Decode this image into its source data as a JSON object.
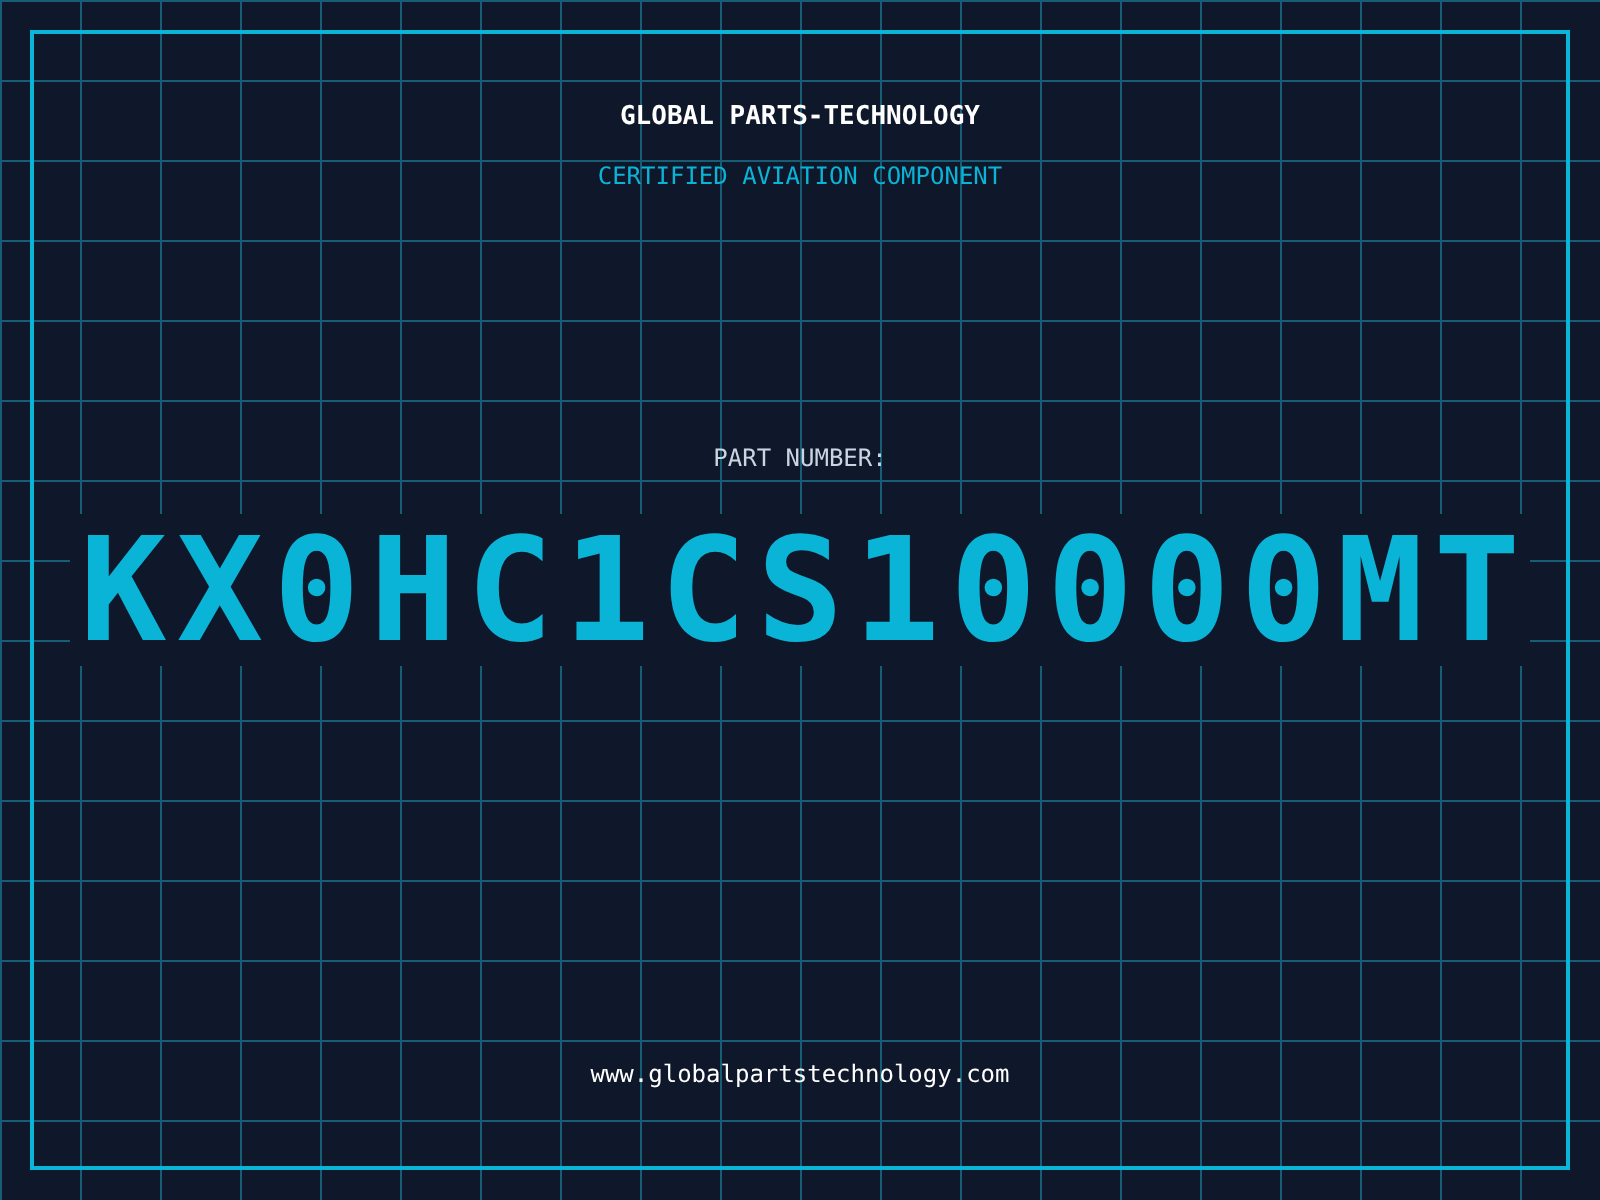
{
  "header": {
    "title": "GLOBAL PARTS-TECHNOLOGY",
    "subtitle": "CERTIFIED AVIATION COMPONENT"
  },
  "part": {
    "label": "PART NUMBER:",
    "number": "KX0HC1CS10000MT"
  },
  "footer": {
    "url": "www.globalpartstechnology.com"
  }
}
